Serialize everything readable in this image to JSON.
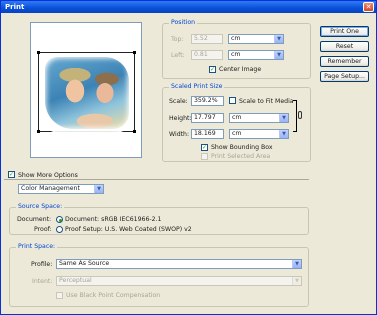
{
  "window": {
    "title": "Print"
  },
  "position": {
    "title": "Position",
    "top_label": "Top:",
    "top_value": "5.52",
    "top_unit": "cm",
    "left_label": "Left:",
    "left_value": "0.81",
    "left_unit": "cm",
    "center_image_label": "Center Image",
    "center_image_checked": true
  },
  "scaled": {
    "title": "Scaled Print Size",
    "scale_label": "Scale:",
    "scale_value": "359.2%",
    "scale_to_fit_label": "Scale to Fit Media",
    "height_label": "Height:",
    "height_value": "17.797",
    "height_unit": "cm",
    "width_label": "Width:",
    "width_value": "18.169",
    "width_unit": "cm",
    "show_bounding_box_label": "Show Bounding Box",
    "show_bounding_box_checked": true,
    "print_selected_area_label": "Print Selected Area"
  },
  "buttons": {
    "print_one": "Print One",
    "reset": "Reset",
    "remember": "Remember",
    "page_setup": "Page Setup..."
  },
  "show_more_options_label": "Show More Options",
  "color_management": {
    "dropdown_value": "Color Management",
    "source_space": {
      "title": "Source Space:",
      "document_label": "Document:",
      "document_option": "Document: sRGB IEC61966-2.1",
      "proof_label": "Proof:",
      "proof_option": "Proof Setup: U.S. Web Coated (SWOP) v2",
      "selected": "document"
    },
    "print_space": {
      "title": "Print Space:",
      "profile_label": "Profile:",
      "profile_value": "Same As Source",
      "intent_label": "Intent:",
      "intent_value": "Perceptual",
      "black_point_label": "Use Black Point Compensation"
    }
  }
}
